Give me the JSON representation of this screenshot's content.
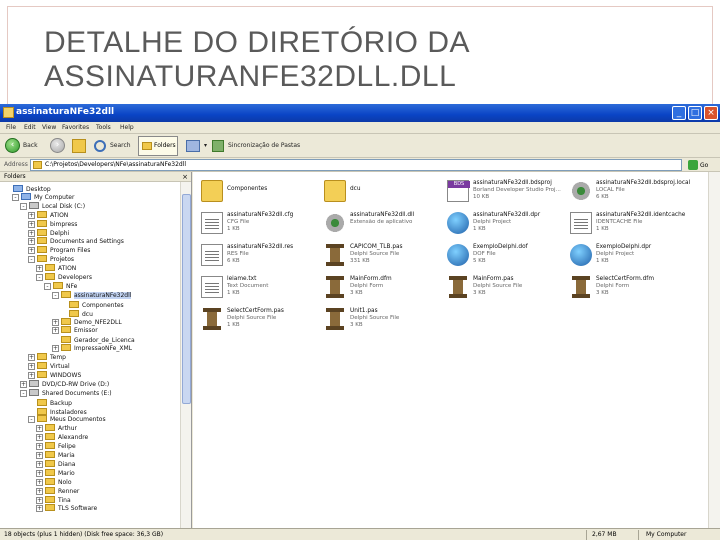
{
  "slide": {
    "title_line1": "DETALHE DO DIRETÓRIO DA",
    "title_line2": "ASSINATURANFE32DLL.DLL"
  },
  "window": {
    "title": "assinaturaNFe32dll",
    "min_label": "_",
    "max_label": "□",
    "close_label": "×"
  },
  "menu": [
    "File",
    "Edit",
    "View",
    "Favorites",
    "Tools",
    "Help"
  ],
  "toolbar": {
    "back_label": "Back",
    "forward_label": "",
    "up_label": "",
    "search_label": "Search",
    "folders_label": "Folders",
    "sync_label": "Sincronização de Pastas"
  },
  "address": {
    "label": "Address",
    "value": "C:\\Projetos\\Developers\\NFe\\assinaturaNFe32dll",
    "go_label": "Go"
  },
  "tree": {
    "header": "Folders",
    "close": "×",
    "items": [
      {
        "label": "Desktop",
        "level": 0,
        "icon": "pc",
        "pm": ""
      },
      {
        "label": "My Computer",
        "level": 1,
        "icon": "pc",
        "pm": "-"
      },
      {
        "label": "Local Disk (C:)",
        "level": 2,
        "icon": "drive",
        "pm": "-"
      },
      {
        "label": "ATION",
        "level": 3,
        "icon": "folder",
        "pm": "+"
      },
      {
        "label": "bimpress",
        "level": 3,
        "icon": "folder",
        "pm": "+"
      },
      {
        "label": "Delphi",
        "level": 3,
        "icon": "folder",
        "pm": "+"
      },
      {
        "label": "Documents and Settings",
        "level": 3,
        "icon": "folder",
        "pm": "+"
      },
      {
        "label": "Program Files",
        "level": 3,
        "icon": "folder",
        "pm": "+"
      },
      {
        "label": "Projetos",
        "level": 3,
        "icon": "folder",
        "pm": "-"
      },
      {
        "label": "ATION",
        "level": 4,
        "icon": "folder",
        "pm": "+"
      },
      {
        "label": "Developers",
        "level": 4,
        "icon": "folder",
        "pm": "-"
      },
      {
        "label": "NFe",
        "level": 5,
        "icon": "folder",
        "pm": "-"
      },
      {
        "label": "assinaturaNFe32dll",
        "level": 6,
        "icon": "folder",
        "pm": "-",
        "selected": true
      },
      {
        "label": "Componentes",
        "level": 7,
        "icon": "folder",
        "pm": ""
      },
      {
        "label": "dcu",
        "level": 7,
        "icon": "folder",
        "pm": ""
      },
      {
        "label": "Demo_NFE2DLL",
        "level": 6,
        "icon": "folder",
        "pm": "+"
      },
      {
        "label": "Emissor",
        "level": 6,
        "icon": "folder",
        "pm": "+"
      },
      {
        "label": "Gerador_de_Licenca",
        "level": 6,
        "icon": "folder",
        "pm": ""
      },
      {
        "label": "ImpressaoNFe_XML",
        "level": 6,
        "icon": "folder",
        "pm": "+"
      },
      {
        "label": "Temp",
        "level": 3,
        "icon": "folder",
        "pm": "+"
      },
      {
        "label": "Virtual",
        "level": 3,
        "icon": "folder",
        "pm": "+"
      },
      {
        "label": "WINDOWS",
        "level": 3,
        "icon": "folder",
        "pm": "+"
      },
      {
        "label": "DVD/CD-RW Drive (D:)",
        "level": 2,
        "icon": "drive",
        "pm": "+"
      },
      {
        "label": "Shared Documents (E:)",
        "level": 2,
        "icon": "drive",
        "pm": "-"
      },
      {
        "label": "Backup",
        "level": 3,
        "icon": "folder",
        "pm": ""
      },
      {
        "label": "Instaladores",
        "level": 3,
        "icon": "folder",
        "pm": ""
      },
      {
        "label": "Meus Documentos",
        "level": 3,
        "icon": "folder",
        "pm": "-"
      },
      {
        "label": "Arthur",
        "level": 4,
        "icon": "folder",
        "pm": "+"
      },
      {
        "label": "Alexandre",
        "level": 4,
        "icon": "folder",
        "pm": "+"
      },
      {
        "label": "Felipe",
        "level": 4,
        "icon": "folder",
        "pm": "+"
      },
      {
        "label": "Maria",
        "level": 4,
        "icon": "folder",
        "pm": "+"
      },
      {
        "label": "Diana",
        "level": 4,
        "icon": "folder",
        "pm": "+"
      },
      {
        "label": "Mario",
        "level": 4,
        "icon": "folder",
        "pm": "+"
      },
      {
        "label": "Nolo",
        "level": 4,
        "icon": "folder",
        "pm": "+"
      },
      {
        "label": "Renner",
        "level": 4,
        "icon": "folder",
        "pm": "+"
      },
      {
        "label": "Tina",
        "level": 4,
        "icon": "folder",
        "pm": "+"
      },
      {
        "label": "TLS Software",
        "level": 4,
        "icon": "folder",
        "pm": "+"
      }
    ]
  },
  "files": [
    {
      "name": "Componentes",
      "type": "",
      "size": "",
      "icon": "folder"
    },
    {
      "name": "dcu",
      "type": "",
      "size": "",
      "icon": "folder"
    },
    {
      "name": "assinaturaNFe32dll.bdsproj",
      "type": "Borland Developer Studio Proj...",
      "size": "10 KB",
      "icon": "bds"
    },
    {
      "name": "assinaturaNFe32dll.bdsproj.local",
      "type": "LOCAL File",
      "size": "6 KB",
      "icon": "gear"
    },
    {
      "name": "assinaturaNFe32dll.cfg",
      "type": "CFG File",
      "size": "1 KB",
      "icon": "doc"
    },
    {
      "name": "assinaturaNFe32dll.dll",
      "type": "Extensão de aplicativo",
      "size": "",
      "icon": "gear"
    },
    {
      "name": "assinaturaNFe32dll.dpr",
      "type": "Delphi Project",
      "size": "1 KB",
      "icon": "globe"
    },
    {
      "name": "assinaturaNFe32dll.identcache",
      "type": "IDENTCACHE File",
      "size": "1 KB",
      "icon": "doc"
    },
    {
      "name": "assinaturaNFe32dll.res",
      "type": "RES File",
      "size": "6 KB",
      "icon": "doc"
    },
    {
      "name": "CAPICOM_TLB.pas",
      "type": "Delphi Source File",
      "size": "331 KB",
      "icon": "pillar"
    },
    {
      "name": "ExemploDelphi.dof",
      "type": "DOF File",
      "size": "5 KB",
      "icon": "globe"
    },
    {
      "name": "ExemploDelphi.dpr",
      "type": "Delphi Project",
      "size": "1 KB",
      "icon": "globe"
    },
    {
      "name": "leiame.txt",
      "type": "Text Document",
      "size": "1 KB",
      "icon": "doc"
    },
    {
      "name": "MainForm.dfm",
      "type": "Delphi Form",
      "size": "3 KB",
      "icon": "pillar"
    },
    {
      "name": "MainForm.pas",
      "type": "Delphi Source File",
      "size": "3 KB",
      "icon": "pillar"
    },
    {
      "name": "SelectCertForm.dfm",
      "type": "Delphi Form",
      "size": "3 KB",
      "icon": "pillar"
    },
    {
      "name": "SelectCertForm.pas",
      "type": "Delphi Source File",
      "size": "1 KB",
      "icon": "pillar"
    },
    {
      "name": "Unit1.pas",
      "type": "Delphi Source File",
      "size": "3 KB",
      "icon": "pillar"
    }
  ],
  "status": {
    "left": "18 objects (plus 1 hidden) (Disk free space: 36,3 GB)",
    "size": "2,67 MB",
    "location": "My Computer"
  }
}
